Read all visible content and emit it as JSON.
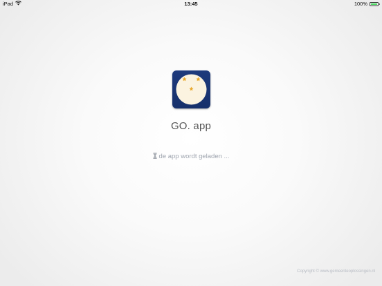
{
  "status_bar": {
    "device": "iPad",
    "time": "13:45",
    "battery": "100%",
    "battery_level": 1.0,
    "battery_color": "#4cd964"
  },
  "app": {
    "icon": "app-logo-icon",
    "name": "GO. app",
    "loading_icon": "hourglass-icon",
    "loading_text": "de app wordt geladen ...",
    "copyright": "Copyright © www.gemeenteoplossingen.nl"
  },
  "colors": {
    "icon_background": "#1e3a7c",
    "icon_disc": "#fbf3e0",
    "icon_accent": "#e8a21d"
  }
}
